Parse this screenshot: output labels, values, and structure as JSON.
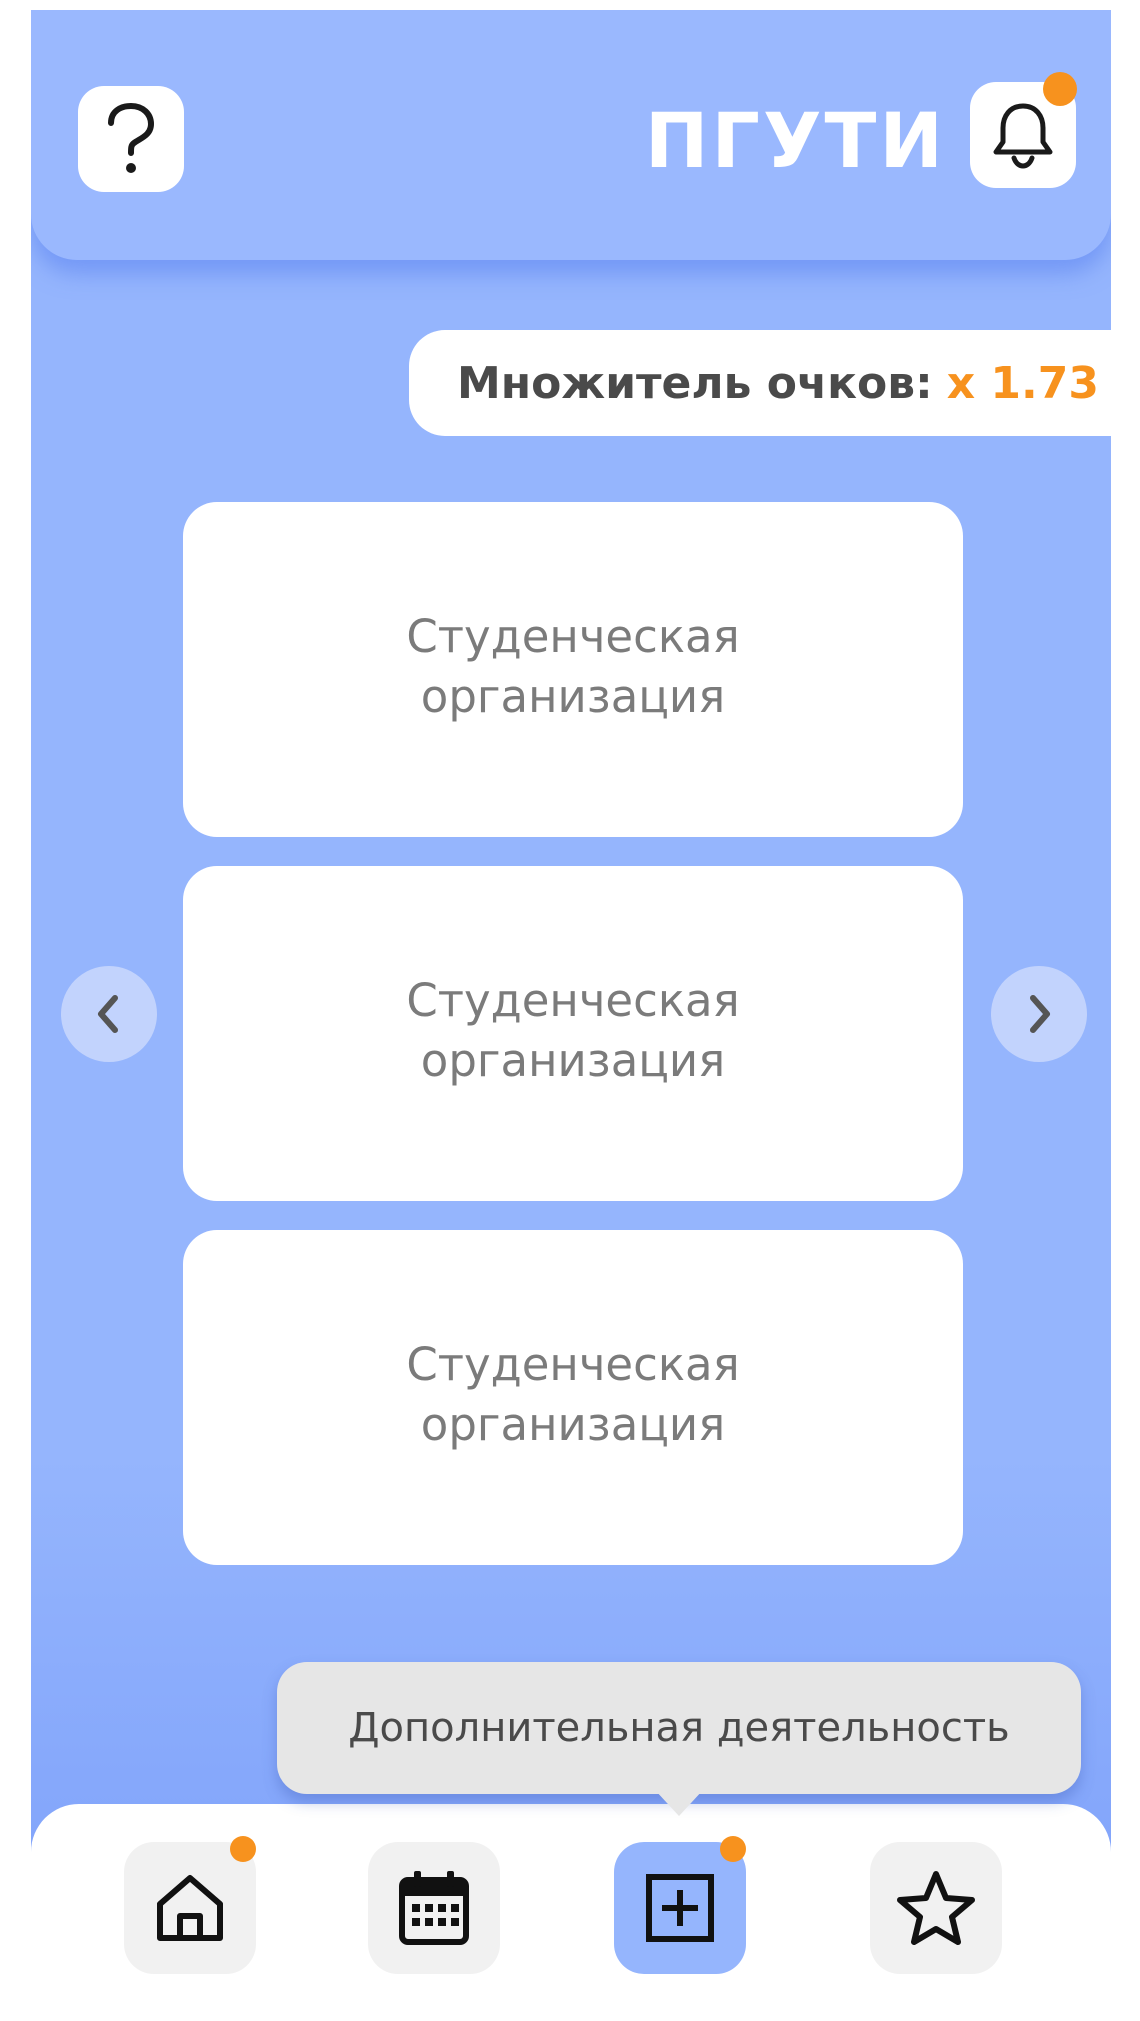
{
  "header": {
    "brand": "ПГУТИ",
    "help_icon": "question-icon",
    "notifications_icon": "bell-icon",
    "has_notification": true
  },
  "multiplier": {
    "label": "Множитель очков:",
    "value": "x 1.73"
  },
  "cards": [
    {
      "title": "Студенческая организация"
    },
    {
      "title": "Студенческая организация"
    },
    {
      "title": "Студенческая организация"
    }
  ],
  "carousel": {
    "prev_icon": "chevron-left-icon",
    "next_icon": "chevron-right-icon"
  },
  "tooltip": {
    "text": "Дополнительная деятельность"
  },
  "nav": {
    "items": [
      {
        "icon": "home-icon",
        "badge": true,
        "active": false
      },
      {
        "icon": "calendar-icon",
        "badge": false,
        "active": false
      },
      {
        "icon": "add-square-icon",
        "badge": true,
        "active": true
      },
      {
        "icon": "star-icon",
        "badge": false,
        "active": false
      }
    ]
  },
  "colors": {
    "background": "#95b5fd",
    "accent": "#f7921e",
    "card": "#ffffff",
    "card_text": "#7b7b7b"
  }
}
